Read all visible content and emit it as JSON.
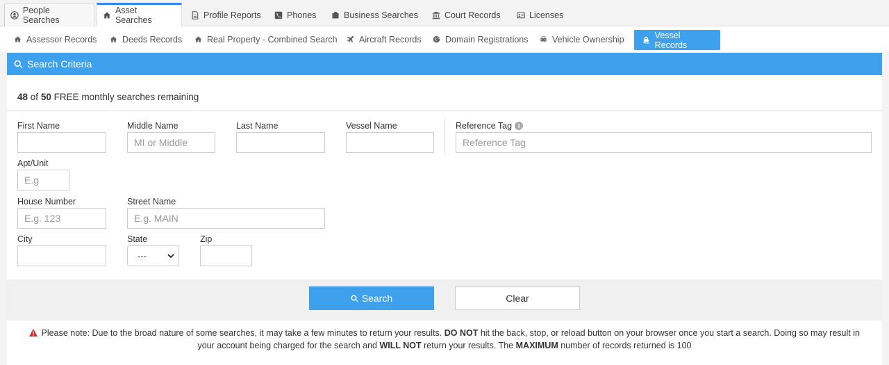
{
  "top_tabs": [
    {
      "label": "People Searches",
      "icon": "user-circle-icon"
    },
    {
      "label": "Asset Searches",
      "icon": "home-icon"
    },
    {
      "label": "Profile Reports",
      "icon": "file-icon"
    },
    {
      "label": "Phones",
      "icon": "phone-icon"
    },
    {
      "label": "Business Searches",
      "icon": "briefcase-icon"
    },
    {
      "label": "Court Records",
      "icon": "institution-icon"
    },
    {
      "label": "Licenses",
      "icon": "id-card-icon"
    }
  ],
  "sub_tabs": [
    {
      "label": "Assessor Records",
      "icon": "home-icon"
    },
    {
      "label": "Deeds Records",
      "icon": "home-icon"
    },
    {
      "label": "Real Property - Combined Search",
      "icon": "home-icon"
    },
    {
      "label": "Aircraft Records",
      "icon": "plane-icon"
    },
    {
      "label": "Domain Registrations",
      "icon": "globe-icon"
    },
    {
      "label": "Vehicle Ownership",
      "icon": "car-icon"
    },
    {
      "label": "Vessel Records",
      "icon": "ship-icon"
    }
  ],
  "panel": {
    "title": "Search Criteria",
    "quota_used": "48",
    "quota_of": "of",
    "quota_total": "50",
    "quota_suffix": "FREE monthly searches remaining"
  },
  "fields": {
    "first_name": {
      "label": "First Name",
      "placeholder": ""
    },
    "middle_name": {
      "label": "Middle Name",
      "placeholder": "MI or Middle"
    },
    "last_name": {
      "label": "Last Name",
      "placeholder": ""
    },
    "vessel_name": {
      "label": "Vessel Name",
      "placeholder": ""
    },
    "reference_tag": {
      "label": "Reference Tag",
      "placeholder": "Reference Tag"
    },
    "apt_unit": {
      "label": "Apt/Unit",
      "placeholder": "E.g"
    },
    "house_number": {
      "label": "House Number",
      "placeholder": "E.g. 123"
    },
    "street_name": {
      "label": "Street Name",
      "placeholder": "E.g. MAIN"
    },
    "city": {
      "label": "City",
      "placeholder": ""
    },
    "state": {
      "label": "State",
      "value": "---"
    },
    "zip": {
      "label": "Zip",
      "placeholder": ""
    }
  },
  "buttons": {
    "search": "Search",
    "clear": "Clear"
  },
  "notice": {
    "part1": "Please note: Due to the broad nature of some searches, it may take a few minutes to return your results.",
    "bold1": "DO NOT",
    "part2": "hit the back, stop, or reload button on your browser once you start a search. Doing so may result in your account being charged for the search and",
    "bold2": "WILL NOT",
    "part3": "return your results. The",
    "bold3": "MAXIMUM",
    "part4": "number of records returned is 100"
  },
  "colors": {
    "accent": "#3da1ee",
    "warning": "#c9302c"
  }
}
